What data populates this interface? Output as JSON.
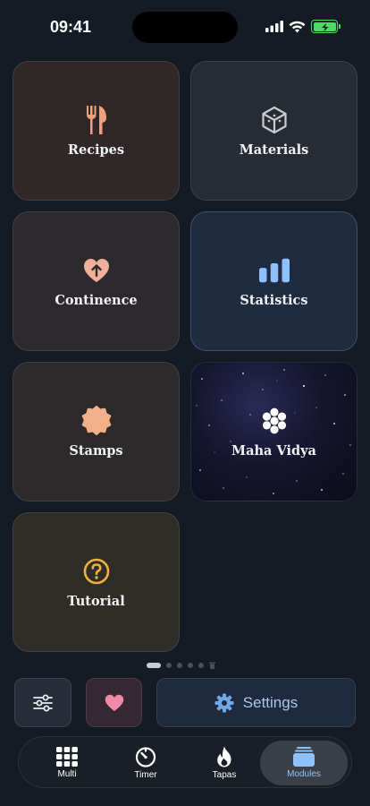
{
  "status_bar": {
    "time": "09:41"
  },
  "modules": [
    {
      "label": "Recipes",
      "icon": "fork-knife-icon",
      "color": "#f0a07c"
    },
    {
      "label": "Materials",
      "icon": "cube-icon",
      "color": "#c8ccd2"
    },
    {
      "label": "Continence",
      "icon": "heart-arrow-icon",
      "color": "#f2b09a"
    },
    {
      "label": "Statistics",
      "icon": "bar-chart-icon",
      "color": "#8fc0ff"
    },
    {
      "label": "Stamps",
      "icon": "seal-badge-icon",
      "color": "#f2b08a"
    },
    {
      "label": "Maha Vidya",
      "icon": "flower-icon",
      "color": "#ffffff"
    },
    {
      "label": "Tutorial",
      "icon": "question-circle-icon",
      "color": "#f0b040"
    }
  ],
  "page_indicator": {
    "pages": 5,
    "current": 1
  },
  "quick_actions": {
    "filters_icon": "sliders-icon",
    "favorite_icon": "heart-icon",
    "favorite_color": "#f08aa8",
    "settings_label": "Settings",
    "settings_icon": "gear-icon",
    "settings_color": "#6fa8ea"
  },
  "tab_bar": {
    "tabs": [
      {
        "label": "Multi",
        "icon": "grid-icon"
      },
      {
        "label": "Timer",
        "icon": "timer-icon"
      },
      {
        "label": "Tapas",
        "icon": "flame-icon"
      },
      {
        "label": "Modules",
        "icon": "folders-icon",
        "active": true
      }
    ]
  }
}
